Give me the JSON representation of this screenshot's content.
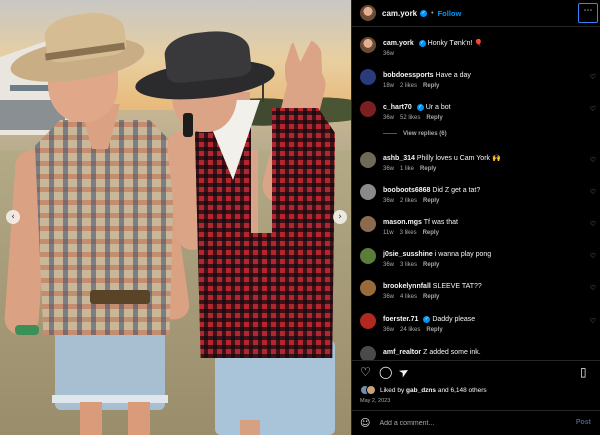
{
  "header": {
    "username": "cam.york",
    "follow_label": "Follow",
    "more_label": "⋯",
    "verified_glyph": "✓"
  },
  "caption": {
    "username": "cam.york",
    "text": "Honky Tønk'n! 🎈",
    "age": "36w"
  },
  "comments": [
    {
      "username": "bobdoessports",
      "text": "Have a day",
      "age": "18w",
      "likes": "2 likes",
      "reply": "Reply",
      "avatar_color": "#2a3a7a"
    },
    {
      "username": "c_hart70",
      "verified": true,
      "text": "Ur a bot",
      "age": "36w",
      "likes": "52 likes",
      "reply": "Reply",
      "avatar_color": "#7a1f22",
      "view_replies": "View replies (6)"
    },
    {
      "username": "ashb_314",
      "text": "Philly loves u Cam York 🙌",
      "age": "36w",
      "likes": "1 like",
      "reply": "Reply",
      "avatar_color": "#6d6a55"
    },
    {
      "username": "booboots6868",
      "text": "Did Z get a tat?",
      "age": "36w",
      "likes": "2 likes",
      "reply": "Reply",
      "avatar_color": "#8a8a8a"
    },
    {
      "username": "mason.mgs",
      "text": "Tf was that",
      "age": "11w",
      "likes": "3 likes",
      "reply": "Reply",
      "avatar_color": "#8c6a4e"
    },
    {
      "username": "j0sie_susshine",
      "text": "i wanna play pong",
      "age": "36w",
      "likes": "3 likes",
      "reply": "Reply",
      "avatar_color": "#5a7d3a"
    },
    {
      "username": "brookelynnfall",
      "text": "SLEEVE TAT??",
      "age": "36w",
      "likes": "4 likes",
      "reply": "Reply",
      "avatar_color": "#9a6b3a"
    },
    {
      "username": "foerster.71",
      "verified": true,
      "text": "Daddy please",
      "age": "36w",
      "likes": "24 likes",
      "reply": "Reply",
      "avatar_color": "#b0281e"
    },
    {
      "username": "amf_realtor",
      "text": "Z added some ink.",
      "age": "",
      "likes": "",
      "reply": "",
      "avatar_color": "#4a4a4a"
    }
  ],
  "likes": {
    "prefix": "Liked by",
    "user": "gab_dzns",
    "suffix": "and 6,148 others"
  },
  "date": "May 2, 2023",
  "add_comment": {
    "placeholder": "Add a comment...",
    "post_label": "Post"
  },
  "icons": {
    "heart": "♡",
    "comment": "◯",
    "share": "➤",
    "save": "▯",
    "emoji": "☺",
    "arrow_left": "‹",
    "arrow_right": "›"
  },
  "colors": {
    "accent": "#0095f6",
    "background": "#000000",
    "secondary_text": "#a8a8a8"
  }
}
